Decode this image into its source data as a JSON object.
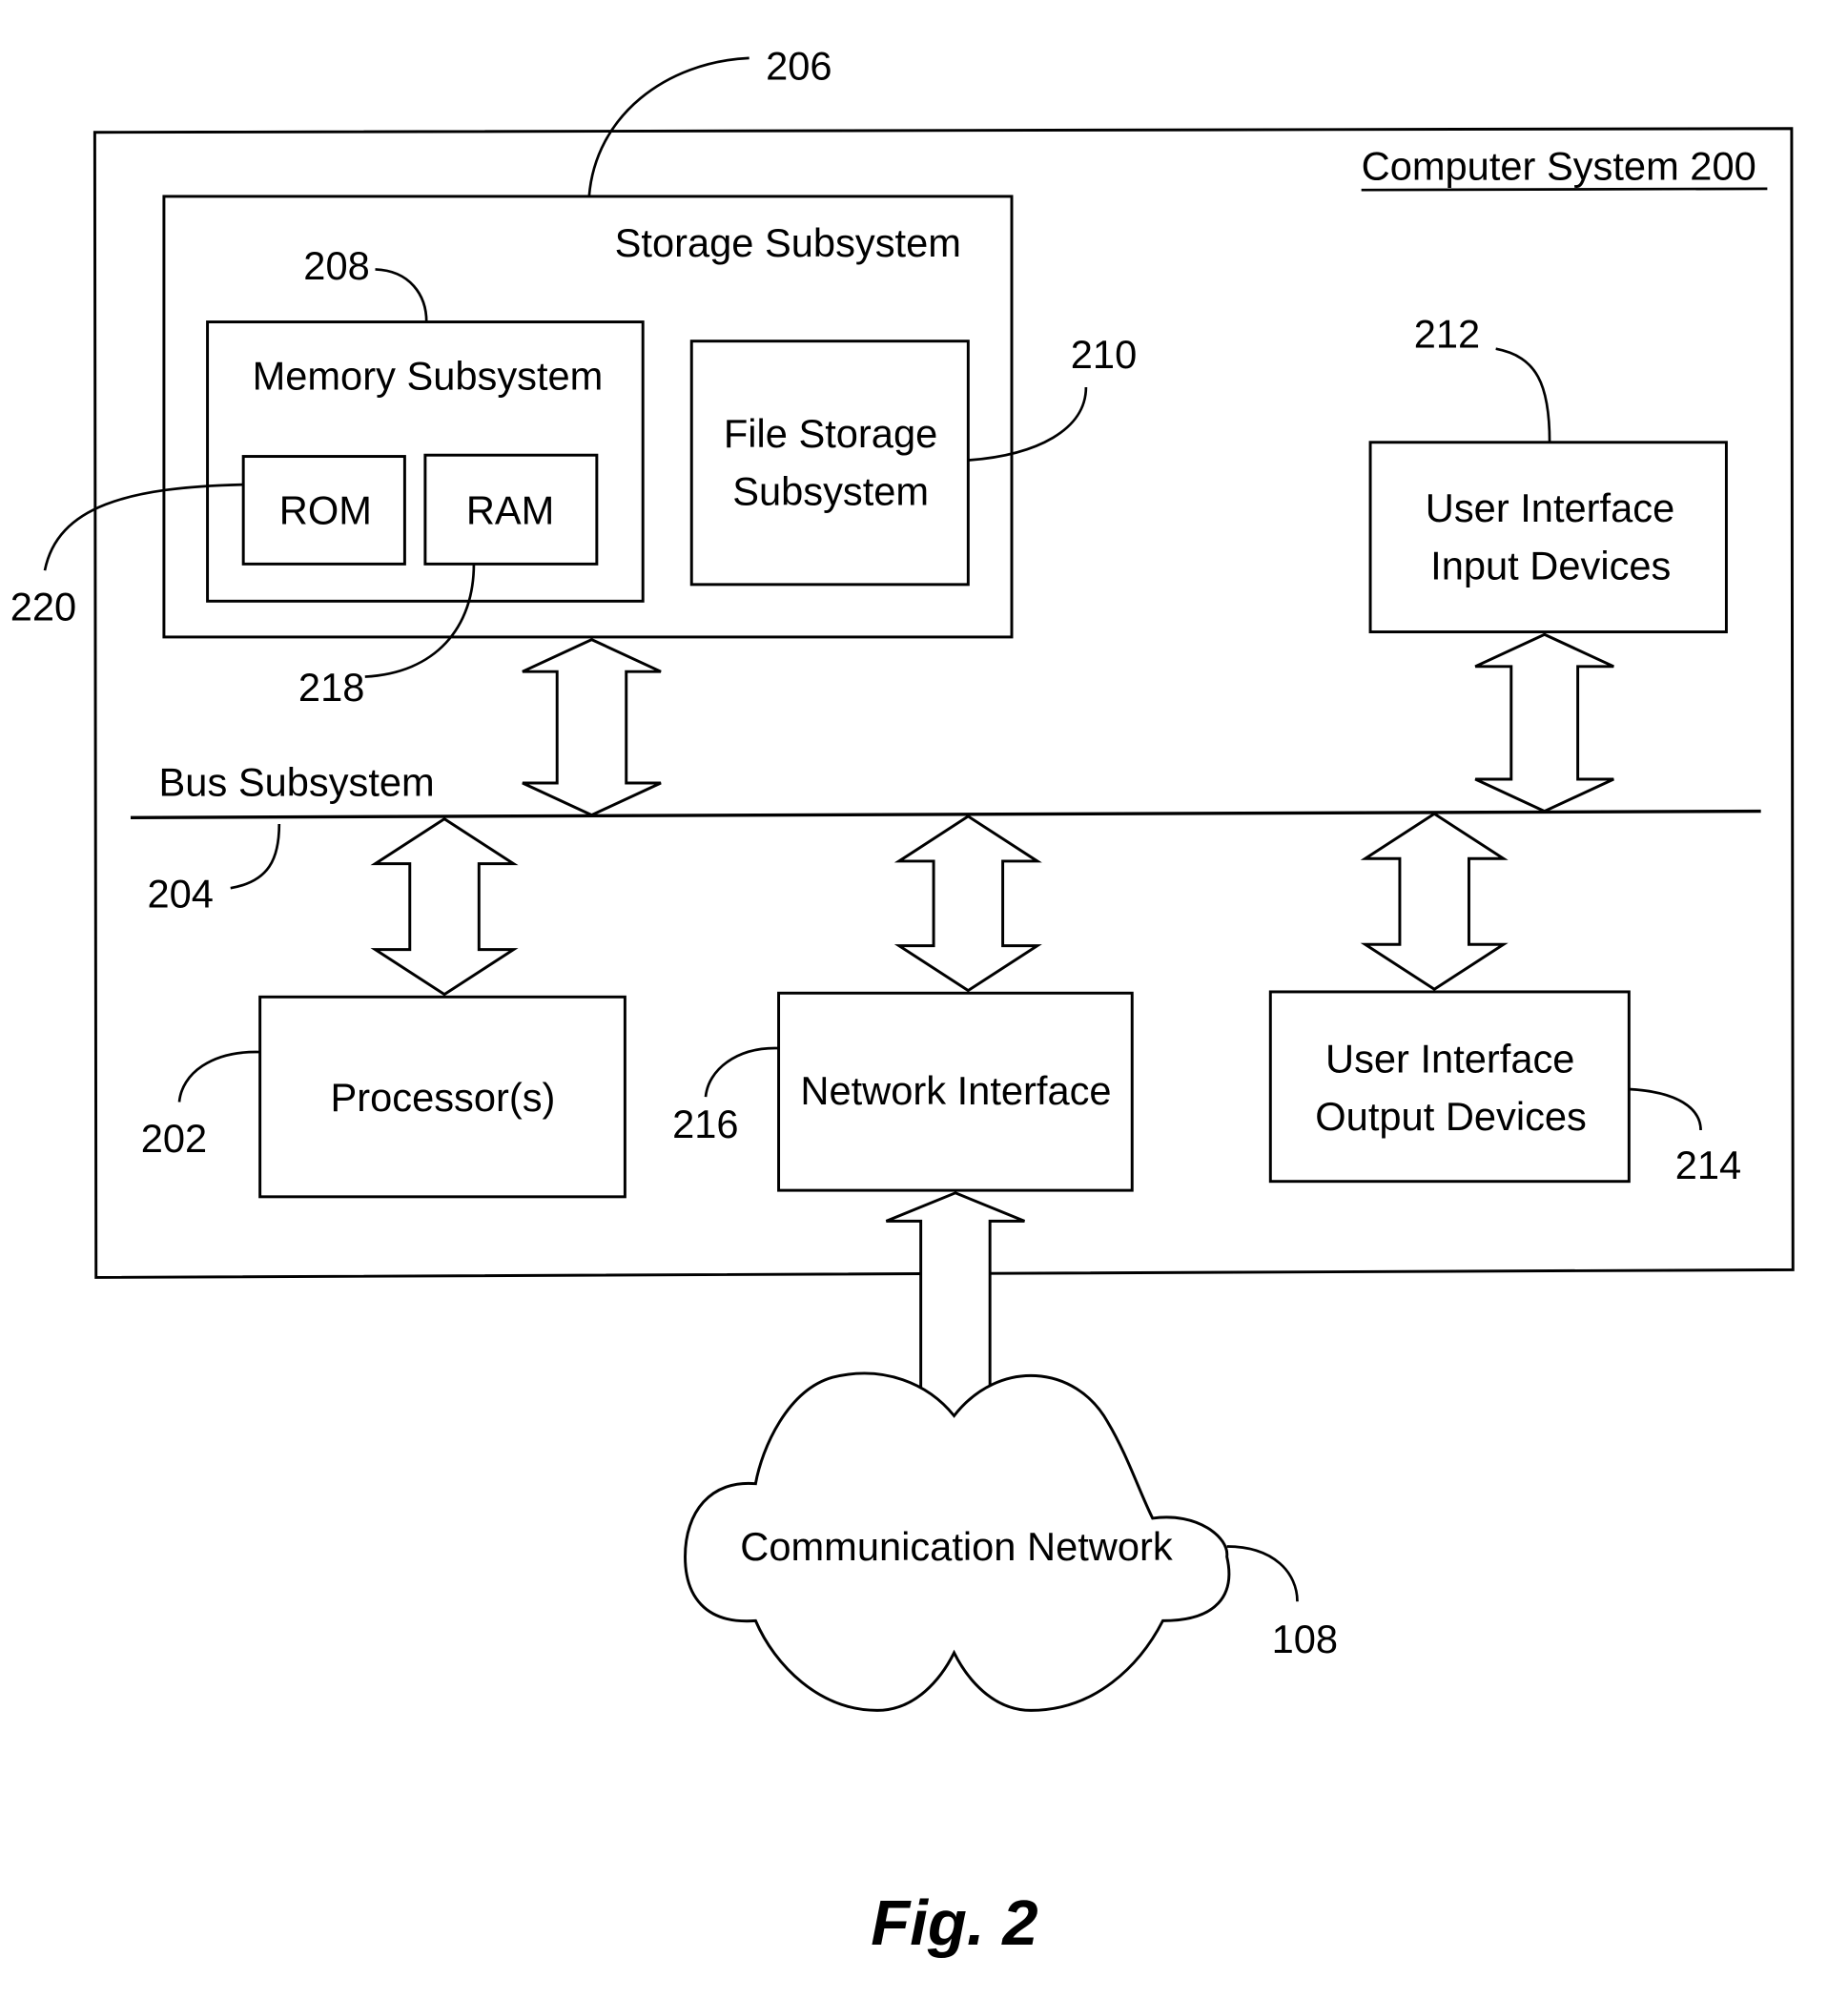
{
  "figure": {
    "caption": "Fig. 2",
    "system": {
      "label": "Computer System  200"
    },
    "storage_subsystem": {
      "label": "Storage Subsystem",
      "ref": "206"
    },
    "memory_subsystem": {
      "label": "Memory Subsystem",
      "ref": "208"
    },
    "rom": {
      "label": "ROM",
      "ref": "220"
    },
    "ram": {
      "label": "RAM",
      "ref": "218"
    },
    "file_storage": {
      "label_line1": "File Storage",
      "label_line2": "Subsystem",
      "ref": "210"
    },
    "ui_input": {
      "label_line1": "User Interface",
      "label_line2": "Input Devices",
      "ref": "212"
    },
    "bus": {
      "label": "Bus Subsystem",
      "ref": "204"
    },
    "processor": {
      "label": "Processor(s)",
      "ref": "202"
    },
    "network_interface": {
      "label": "Network Interface",
      "ref": "216"
    },
    "ui_output": {
      "label_line1": "User Interface",
      "label_line2": "Output Devices",
      "ref": "214"
    },
    "network": {
      "label": "Communication Network",
      "ref": "108"
    }
  }
}
